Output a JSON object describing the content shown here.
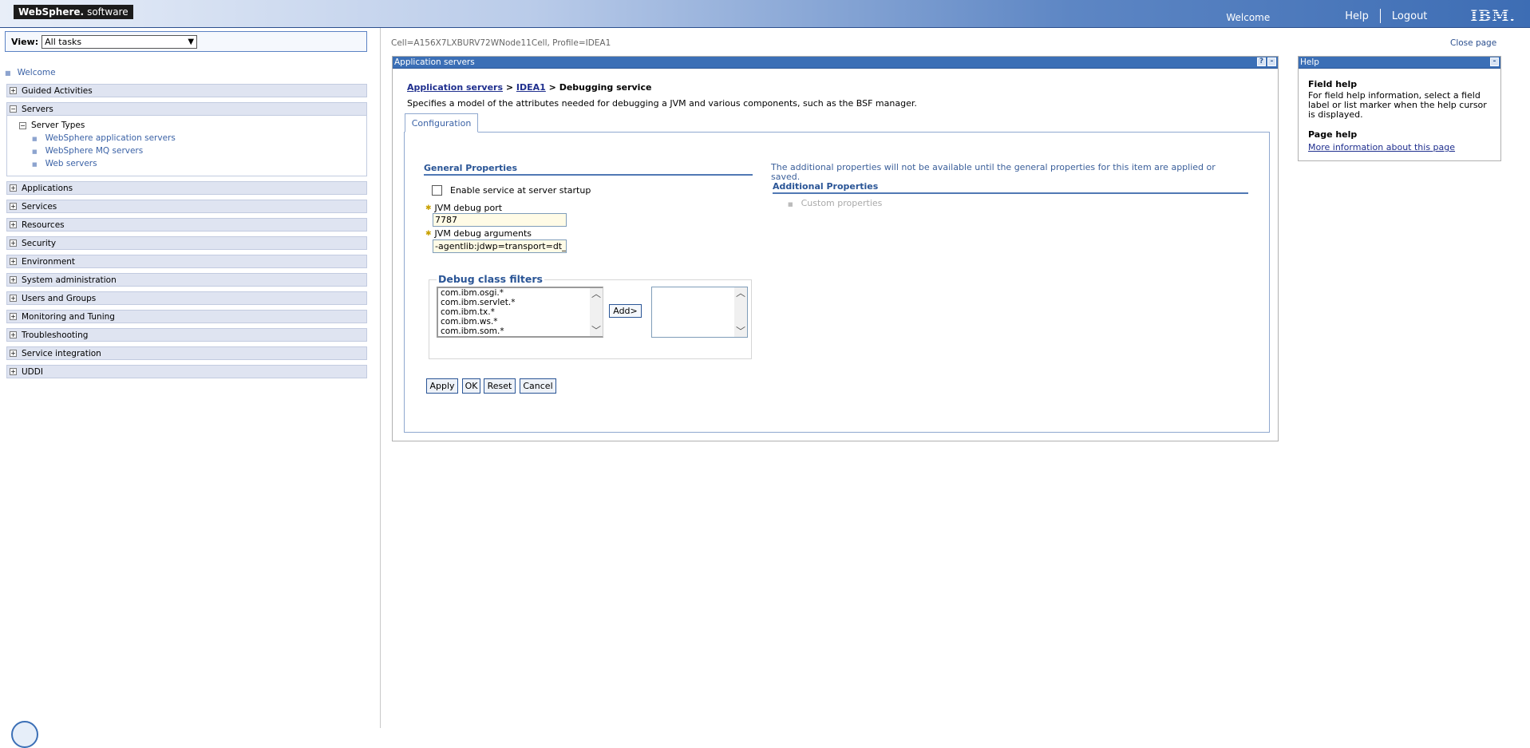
{
  "header": {
    "brand_bold": "WebSphere.",
    "brand_light": "software",
    "welcome": "Welcome",
    "help": "Help",
    "logout": "Logout",
    "ibm": "IBM."
  },
  "nav": {
    "view_label": "View:",
    "view_value": "All tasks",
    "welcome": "Welcome",
    "sections": {
      "guided": "Guided Activities",
      "servers": "Servers",
      "applications": "Applications",
      "services": "Services",
      "resources": "Resources",
      "security": "Security",
      "environment": "Environment",
      "sysadmin": "System administration",
      "users": "Users and Groups",
      "monitoring": "Monitoring and Tuning",
      "troubleshooting": "Troubleshooting",
      "serviceint": "Service integration",
      "uddi": "UDDI"
    },
    "server_types": "Server Types",
    "server_items": [
      "WebSphere application servers",
      "WebSphere MQ servers",
      "Web servers"
    ]
  },
  "cell_info": "Cell=A156X7LXBURV72WNode11Cell, Profile=IDEA1",
  "close_page": "Close page",
  "panel": {
    "title": "Application servers",
    "help_icon": "?",
    "min_icon": "-",
    "breadcrumb": {
      "link1": "Application servers",
      "sep": " > ",
      "link2": "IDEA1",
      "current": "Debugging service"
    },
    "description": "Specifies a model of the attributes needed for debugging a JVM and various components, such as the BSF manager.",
    "tab": "Configuration",
    "general_properties": "General Properties",
    "enable_label": "Enable service at server startup",
    "jvm_port_label": "JVM debug port",
    "jvm_port_value": "7787",
    "jvm_args_label": "JVM debug arguments",
    "jvm_args_value": "-agentlib:jdwp=transport=dt_s",
    "debug_filters_legend": "Debug class filters",
    "debug_filters": [
      "com.ibm.osgi.*",
      "com.ibm.servlet.*",
      "com.ibm.tx.*",
      "com.ibm.ws.*",
      "com.ibm.som.*"
    ],
    "add_button": "Add>",
    "additional_note": "The additional properties will not be available until the general properties for this item are applied or saved.",
    "additional_properties": "Additional Properties",
    "custom_properties": "Custom properties",
    "buttons": {
      "apply": "Apply",
      "ok": "OK",
      "reset": "Reset",
      "cancel": "Cancel"
    }
  },
  "help": {
    "title": "Help",
    "field_help": "Field help",
    "field_help_text": "For field help information, select a field label or list marker when the help cursor is displayed.",
    "page_help": "Page help",
    "page_help_link": "More information about this page"
  }
}
